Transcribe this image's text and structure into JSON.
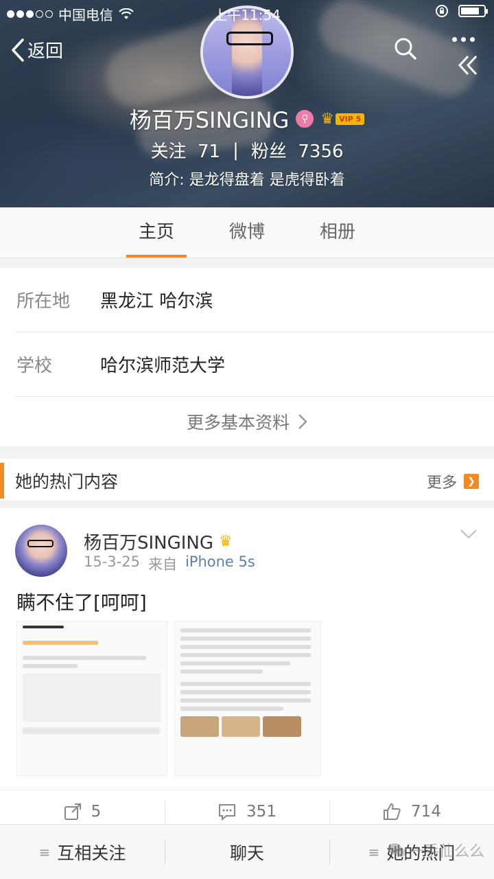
{
  "status_bar": {
    "carrier": "中国电信",
    "time": "上午11:54"
  },
  "nav": {
    "back_label": "返回"
  },
  "profile": {
    "name": "杨百万SINGING",
    "vip_label": "VIP 5",
    "follow_label": "关注",
    "follow_count": "71",
    "separator": "|",
    "fans_label": "粉丝",
    "fans_count": "7356",
    "bio": "简介: 是龙得盘着 是虎得卧着"
  },
  "tabs": [
    {
      "label": "主页",
      "active": true
    },
    {
      "label": "微博",
      "active": false
    },
    {
      "label": "相册",
      "active": false
    }
  ],
  "info": {
    "rows": [
      {
        "label": "所在地",
        "value": "黑龙江 哈尔滨"
      },
      {
        "label": "学校",
        "value": "哈尔滨师范大学"
      }
    ],
    "more_label": "更多基本资料"
  },
  "hot": {
    "title": "她的热门内容",
    "more_label": "更多",
    "post": {
      "author": "杨百万SINGING",
      "date": "15-3-25",
      "source_prefix": "来自",
      "source": "iPhone 5s",
      "text": "瞒不住了[呵呵]"
    }
  },
  "actions": {
    "repost_count": "5",
    "comment_count": "351",
    "like_count": "714"
  },
  "bottom_bar": {
    "follow_each": "互相关注",
    "chat": "聊天",
    "hot": "她的热门"
  },
  "watermark": "一手仙么么",
  "colors": {
    "accent": "#f08a24",
    "link": "#5b7fae",
    "vip": "#f5b400"
  }
}
